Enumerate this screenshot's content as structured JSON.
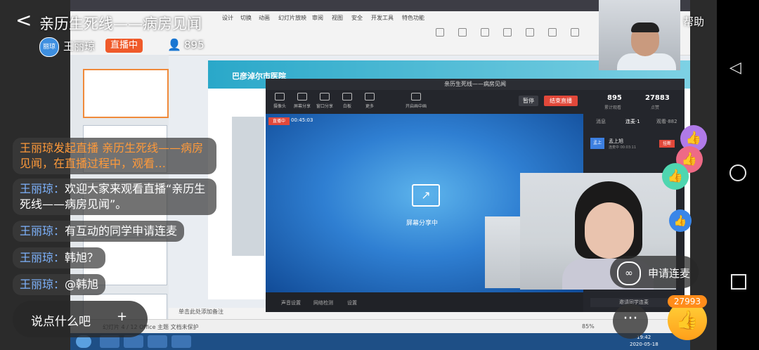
{
  "header": {
    "title": "亲历生死线——病房见闻",
    "help": "帮助",
    "host_avatar_text": "丽琼",
    "host_name": "王丽琼",
    "live_status": "直播中",
    "viewer_count": "895"
  },
  "chat": [
    {
      "text": "王丽琼发起直播 亲历生死线——病房见闻，在直播过程中，观看…",
      "type": "system"
    },
    {
      "name": "王丽琼：",
      "text": "欢迎大家来观看直播“亲历生死线——病房见闻”。"
    },
    {
      "name": "王丽琼：",
      "text": "有互动的同学申请连麦"
    },
    {
      "name": "王丽琼：",
      "text": "韩旭？"
    },
    {
      "name": "王丽琼：",
      "text": "@韩旭"
    }
  ],
  "input": {
    "placeholder": "说点什么吧",
    "plus": "+"
  },
  "actions": {
    "apply_mic": "申请连麦",
    "more": "···",
    "like_count": "27993"
  },
  "ppt": {
    "menus": [
      "设计",
      "切换",
      "动画",
      "幻灯片放映",
      "审阅",
      "视图",
      "安全",
      "开发工具",
      "特色功能"
    ],
    "hospital": "巴彦淖尔市医院",
    "notes": "单击此处添加备注",
    "status_left": "幻灯片 4 / 12    Office 主题    文档未保护",
    "zoom": "85%",
    "clock_time": "19:42",
    "clock_date": "2020-05-18"
  },
  "live_window": {
    "title": "亲历生死线——病房见闻",
    "tools": [
      "摄像头",
      "屏幕分享",
      "窗口分享",
      "白板",
      "更多",
      "开启画中画"
    ],
    "pause": "暂停",
    "end": "结束直播",
    "badge": "直播中",
    "elapsed": "00:45:03",
    "share_text": "屏幕分享中",
    "bottom": [
      "声音设置",
      "网络检测",
      "设置"
    ],
    "stats": {
      "viewers": "895",
      "viewers_label": "累计观看",
      "likes": "27883",
      "likes_label": "点赞"
    },
    "panel_tabs": [
      "消息",
      "连麦·1",
      "观看·882"
    ],
    "member": {
      "avatar": "孟上",
      "name": "孟上旭",
      "sub": "连麦中 00:03:11",
      "hangup": "挂断"
    },
    "apply_link": "邀请同学连麦"
  }
}
